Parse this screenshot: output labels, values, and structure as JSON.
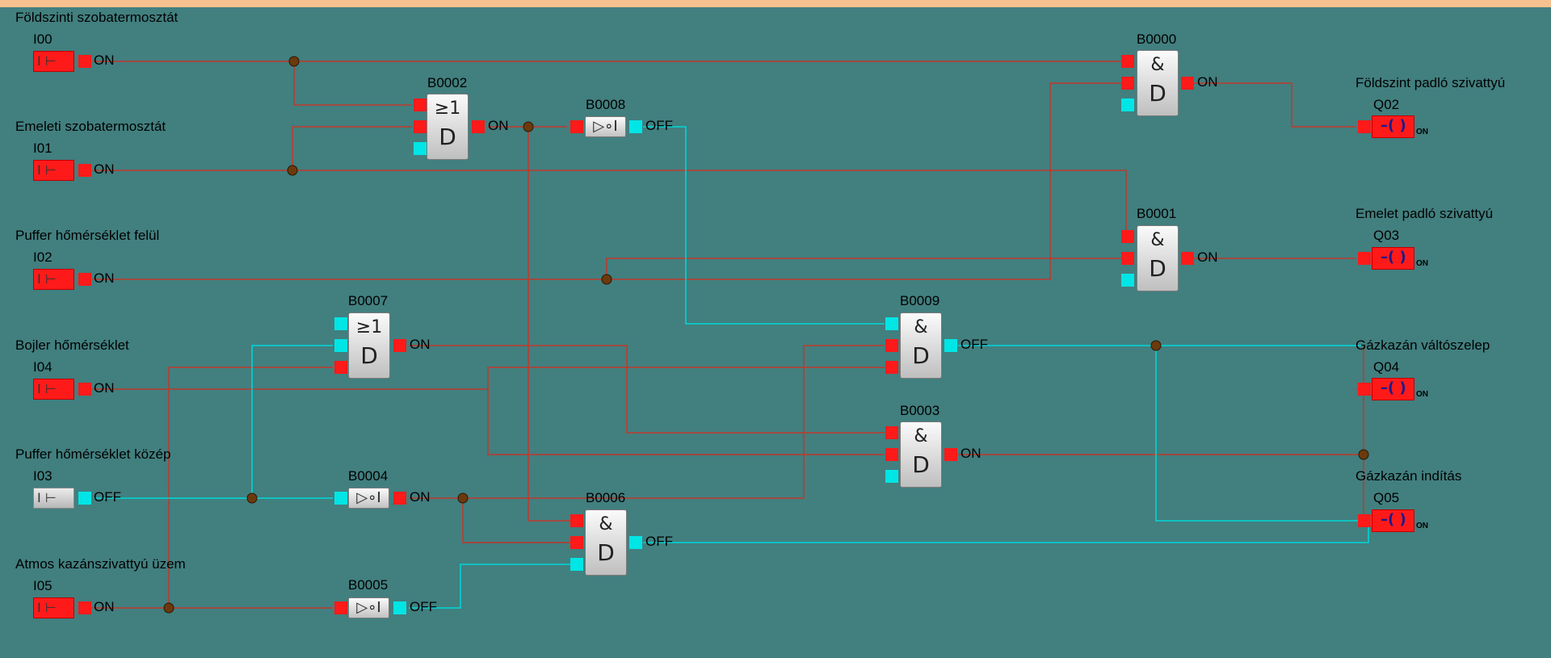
{
  "inputs": [
    {
      "id": "I00",
      "name": "Földszinti szobatermosztát",
      "state": "ON"
    },
    {
      "id": "I01",
      "name": "Emeleti szobatermosztát",
      "state": "ON"
    },
    {
      "id": "I02",
      "name": "Puffer hőmérséklet felül",
      "state": "ON"
    },
    {
      "id": "I04",
      "name": "Bojler hőmérséklet",
      "state": "ON"
    },
    {
      "id": "I03",
      "name": "Puffer hőmérséklet közép",
      "state": "OFF"
    },
    {
      "id": "I05",
      "name": "Atmos kazánszivattyú üzem",
      "state": "ON"
    }
  ],
  "blocks": [
    {
      "id": "B0002",
      "type": "OR",
      "state": "ON"
    },
    {
      "id": "B0008",
      "type": "NOT",
      "state": "OFF"
    },
    {
      "id": "B0007",
      "type": "OR",
      "state": "ON"
    },
    {
      "id": "B0004",
      "type": "NOT",
      "state": "ON"
    },
    {
      "id": "B0005",
      "type": "NOT",
      "state": "OFF"
    },
    {
      "id": "B0006",
      "type": "AND",
      "state": "OFF"
    },
    {
      "id": "B0009",
      "type": "AND",
      "state": "OFF"
    },
    {
      "id": "B0003",
      "type": "AND",
      "state": "ON"
    },
    {
      "id": "B0000",
      "type": "AND",
      "state": "ON"
    },
    {
      "id": "B0001",
      "type": "AND",
      "state": "ON"
    }
  ],
  "outputs": [
    {
      "id": "Q02",
      "name": "Földszint padló szivattyú",
      "state": "ON"
    },
    {
      "id": "Q03",
      "name": "Emelet padló szivattyú",
      "state": "ON"
    },
    {
      "id": "Q04",
      "name": "Gázkazán váltószelep",
      "state": "ON"
    },
    {
      "id": "Q05",
      "name": "Gázkazán indítás",
      "state": "ON"
    }
  ],
  "symbols": {
    "or_top": "≥1",
    "and_top": "&",
    "gate_bottom": "D",
    "not_symbol": "▷∘I",
    "input_symbol": "I ⊢",
    "output_symbol": "–( )"
  },
  "colors": {
    "background": "#427f7f",
    "signal_on": "#ff1a1a",
    "signal_off": "#00e5e5",
    "wire_on": "#c0392b",
    "wire_off": "#00d8d8",
    "junction": "#6b3a0c",
    "top_bar": "#f7c08f"
  }
}
